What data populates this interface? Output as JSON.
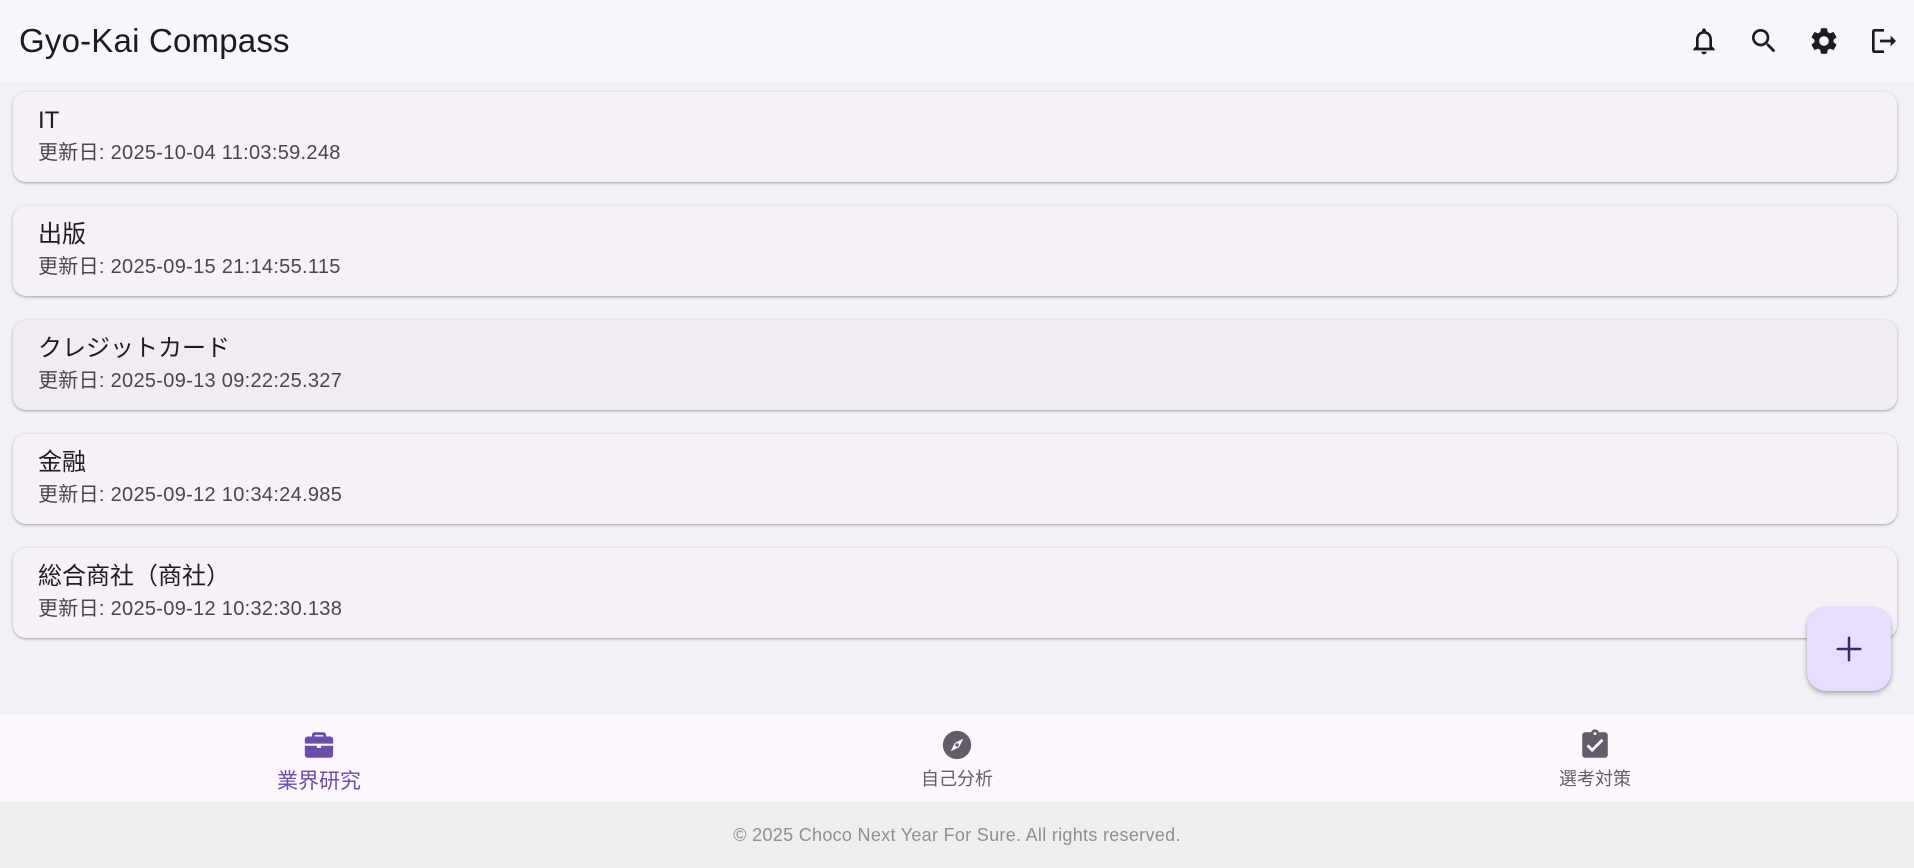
{
  "app": {
    "title": "Gyo-Kai Compass"
  },
  "actions": [
    {
      "name": "notifications-icon"
    },
    {
      "name": "search-icon"
    },
    {
      "name": "settings-icon"
    },
    {
      "name": "logout-icon"
    }
  ],
  "industries": [
    {
      "title": "IT",
      "updated": "更新日: 2025-10-04 11:03:59.248"
    },
    {
      "title": "出版",
      "updated": "更新日: 2025-09-15 21:14:55.115"
    },
    {
      "title": "クレジットカード",
      "updated": "更新日: 2025-09-13 09:22:25.327"
    },
    {
      "title": "金融",
      "updated": "更新日: 2025-09-12 10:34:24.985"
    },
    {
      "title": "総合商社（商社）",
      "updated": "更新日: 2025-09-12 10:32:30.138"
    }
  ],
  "fab": {
    "icon": "add-icon"
  },
  "nav": [
    {
      "label": "業界研究",
      "icon": "briefcase-icon",
      "active": true
    },
    {
      "label": "自己分析",
      "icon": "compass-icon",
      "active": false
    },
    {
      "label": "選考対策",
      "icon": "clipboard-check-icon",
      "active": false
    }
  ],
  "footer": {
    "text": "© 2025 Choco Next Year For Sure. All rights reserved."
  },
  "colors": {
    "accent": "#6a4fa8",
    "fab_bg": "#e9ddff",
    "card_bg": "#f6f1f8",
    "nav_bg": "#fdf6fc"
  }
}
